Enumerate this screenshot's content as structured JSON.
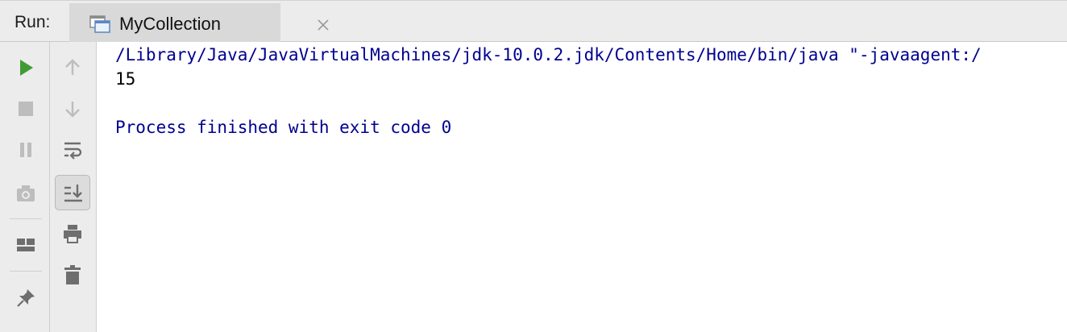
{
  "header": {
    "run_label": "Run:",
    "tab": {
      "title": "MyCollection",
      "icon": "application-window-icon",
      "close_icon": "close-icon"
    }
  },
  "toolbar_left": [
    {
      "name": "rerun-icon",
      "color": "#3f9c35"
    },
    {
      "name": "stop-icon",
      "color": "#bdbdbd"
    },
    {
      "name": "pause-icon",
      "color": "#bdbdbd"
    },
    {
      "name": "camera-icon",
      "color": "#bdbdbd"
    },
    {
      "name": "layout-icon",
      "color": "#6e6e6e"
    },
    {
      "name": "pin-icon",
      "color": "#6e6e6e"
    }
  ],
  "toolbar_right": [
    {
      "name": "arrow-up-icon",
      "color": "#bdbdbd"
    },
    {
      "name": "arrow-down-icon",
      "color": "#bdbdbd"
    },
    {
      "name": "soft-wrap-icon",
      "color": "#6e6e6e"
    },
    {
      "name": "scroll-to-end-icon",
      "color": "#6e6e6e",
      "pressed": true
    },
    {
      "name": "print-icon",
      "color": "#6e6e6e"
    },
    {
      "name": "trash-icon",
      "color": "#6e6e6e"
    }
  ],
  "console": {
    "lines": [
      {
        "text": "/Library/Java/JavaVirtualMachines/jdk-10.0.2.jdk/Contents/Home/bin/java \"-javaagent:/",
        "kind": "system"
      },
      {
        "text": "15",
        "kind": "stdout"
      },
      {
        "text": "",
        "kind": "blank"
      },
      {
        "text": "Process finished with exit code 0",
        "kind": "system"
      }
    ],
    "colors": {
      "system": "#000091",
      "stdout": "#000000"
    }
  }
}
